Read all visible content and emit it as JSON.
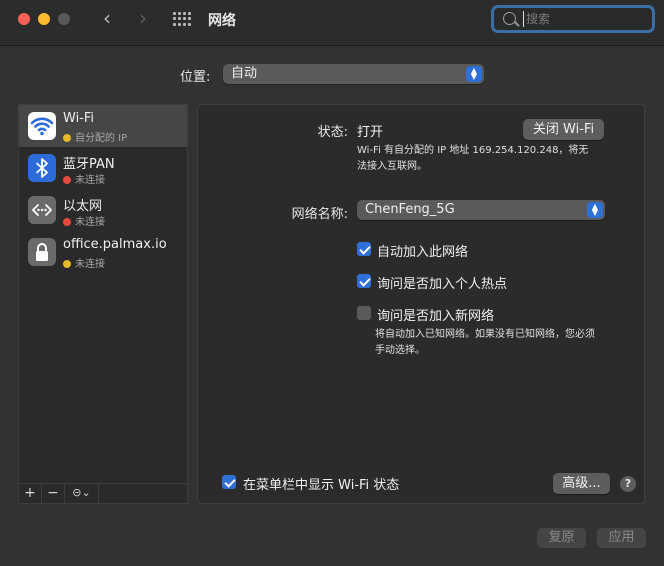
{
  "window": {
    "title": "网络"
  },
  "search": {
    "placeholder": "搜索"
  },
  "location": {
    "label": "位置:",
    "value": "自动"
  },
  "services": [
    {
      "name": "Wi-Fi",
      "status": "自分配的 IP",
      "status_color": "#e5b92e",
      "icon": "wifi-icon",
      "selected": true
    },
    {
      "name": "蓝牙PAN",
      "status": "未连接",
      "status_color": "#e24c3f",
      "icon": "bluetooth-icon"
    },
    {
      "name": "以太网",
      "status": "未连接",
      "status_color": "#e24c3f",
      "icon": "ethernet-icon"
    },
    {
      "name": "office.palmax.io",
      "status": "未连接",
      "status_color": "#e5b92e",
      "icon": "lock-icon"
    }
  ],
  "sidebar_toolbar": {
    "add": "+",
    "remove": "−",
    "action": "⊝⌄"
  },
  "detail": {
    "status_label": "状态:",
    "status_value": "打开",
    "toggle_button": "关闭 Wi-Fi",
    "status_desc_line1": "Wi-Fi 有自分配的 IP 地址 169.254.120.248，将无",
    "status_desc_line2": "法接入互联网。",
    "network_label": "网络名称:",
    "network_value": "ChenFeng_5G",
    "options": [
      {
        "label": "自动加入此网络",
        "checked": true
      },
      {
        "label": "询问是否加入个人热点",
        "checked": true
      },
      {
        "label": "询问是否加入新网络",
        "checked": false
      }
    ],
    "new_network_desc_line1": "将自动加入已知网络。如果没有已知网络，您必须",
    "new_network_desc_line2": "手动选择。",
    "show_in_menubar": {
      "label": "在菜单栏中显示 Wi-Fi 状态",
      "checked": true
    },
    "advanced_button": "高级...",
    "help": "?"
  },
  "footer": {
    "revert": "复原",
    "apply": "应用"
  },
  "colors": {
    "accent": "#2f6fd6",
    "wifi_icon_bg": "#2b6cd8",
    "bluetooth_icon_bg": "#2b6cd8",
    "ethernet_icon_bg": "#6a6a6a",
    "vpn_icon_bg": "#6a6a6a"
  }
}
